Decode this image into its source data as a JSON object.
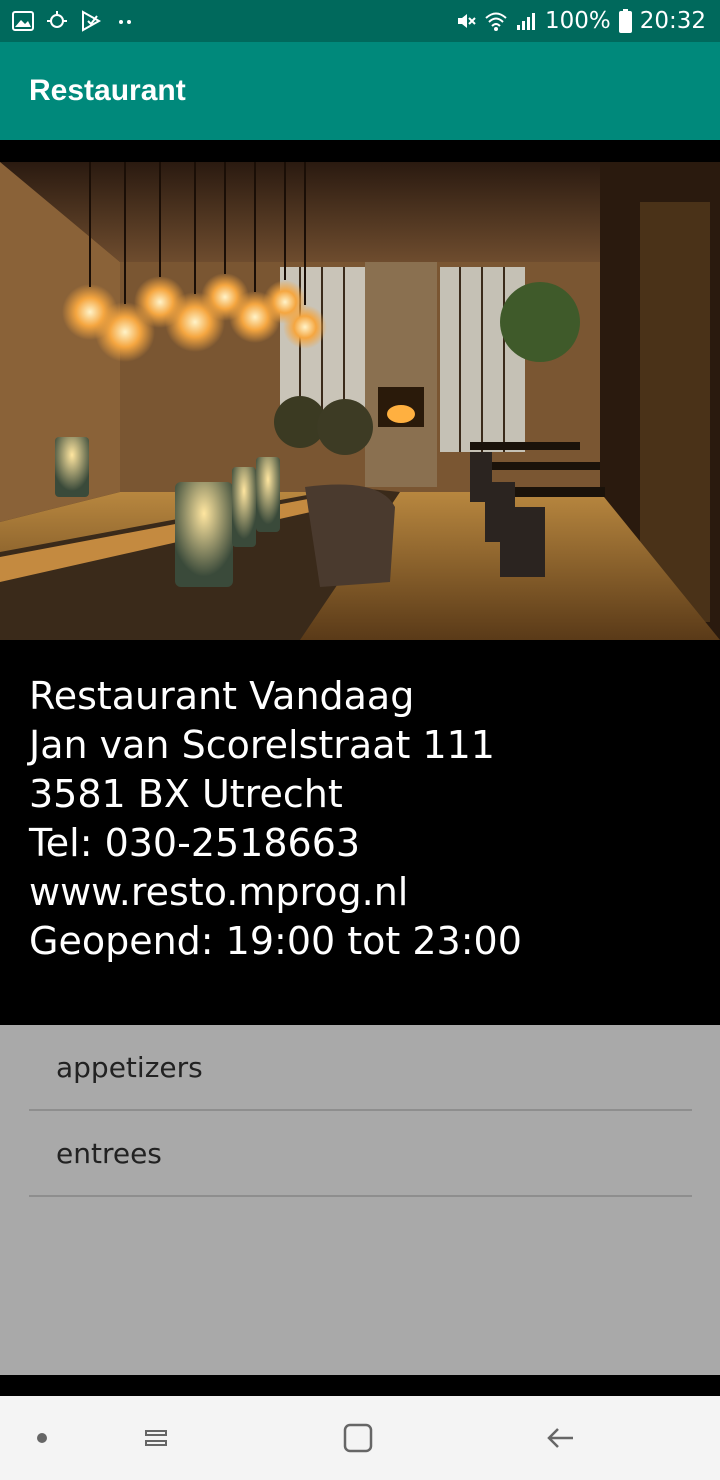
{
  "status_bar": {
    "battery": "100%",
    "time": "20:32",
    "left_icons": [
      "image-icon",
      "sync-icon",
      "play-check-icon",
      "more-dots-icon"
    ],
    "right_icons": [
      "mute-icon",
      "wifi-icon",
      "signal-icon",
      "battery-icon"
    ]
  },
  "app_bar": {
    "title": "Restaurant"
  },
  "restaurant": {
    "name": "Restaurant Vandaag",
    "street": "Jan van Scorelstraat 111",
    "city": "3581 BX Utrecht",
    "phone": "Tel: 030-2518663",
    "website": "www.resto.mprog.nl",
    "hours": "Geopend: 19:00 tot 23:00"
  },
  "categories": [
    {
      "label": "appetizers"
    },
    {
      "label": "entrees"
    }
  ],
  "nav_bar": {
    "icons": [
      "dot-icon",
      "recents-icon",
      "home-icon",
      "back-icon"
    ]
  },
  "colors": {
    "status_bar": "#00695c",
    "app_bar": "#00897b",
    "list_background": "#a9a9a9",
    "nav_bar": "#f4f4f4"
  }
}
